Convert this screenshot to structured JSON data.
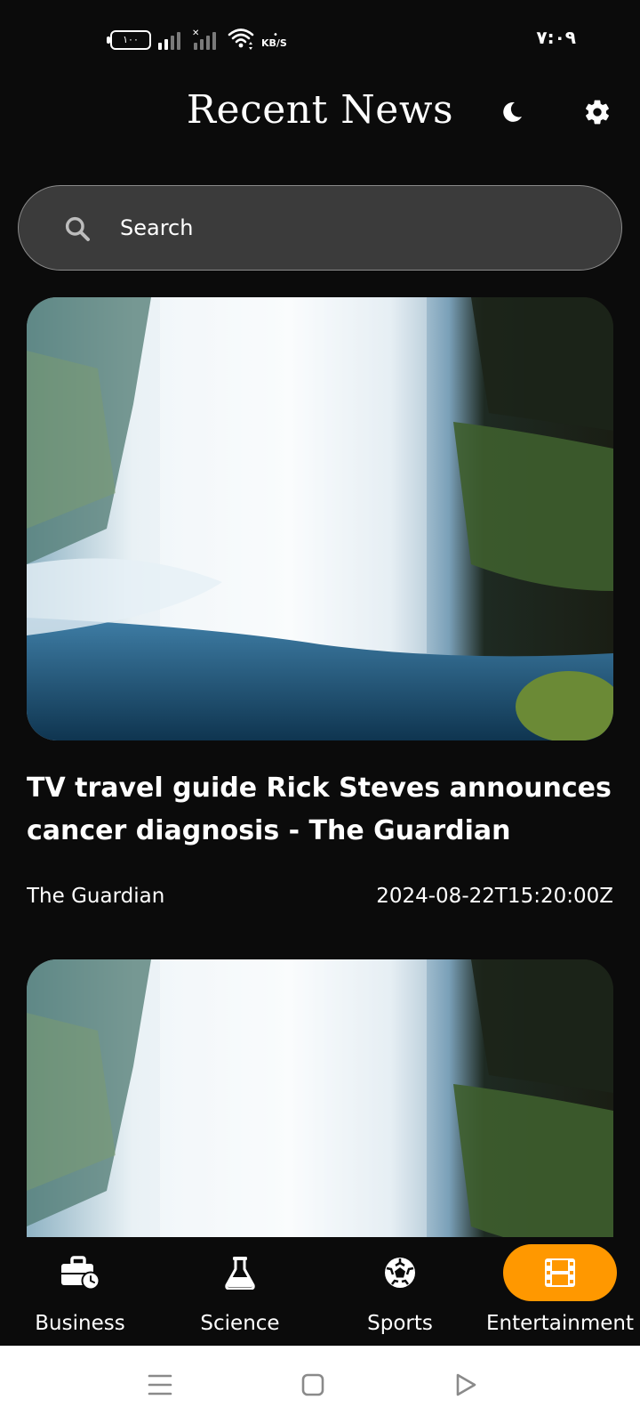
{
  "status_bar": {
    "battery": "١٠٠",
    "speed_unit": "KB/S",
    "time": "٧:٠٩"
  },
  "header": {
    "title": "Recent News",
    "icons": [
      "moon-icon",
      "gear-icon"
    ]
  },
  "search": {
    "placeholder": "Search",
    "icon": "search-icon"
  },
  "articles": [
    {
      "headline": "TV travel guide Rick Steves announces cancer diagnosis - The Guardian",
      "source": "The Guardian",
      "published": "2024-08-22T15:20:00Z",
      "image": "waterfall-image"
    },
    {
      "image": "waterfall-image"
    }
  ],
  "bottom_nav": {
    "items": [
      {
        "label": "Business",
        "icon": "briefcase-clock-icon",
        "active": false
      },
      {
        "label": "Science",
        "icon": "flask-icon",
        "active": false
      },
      {
        "label": "Sports",
        "icon": "soccer-ball-icon",
        "active": false
      },
      {
        "label": "Entertainment",
        "icon": "film-icon",
        "active": true
      }
    ],
    "active_color": "#ff9800"
  },
  "system_nav": {
    "icons": [
      "menu-icon",
      "home-icon",
      "back-icon"
    ]
  },
  "colors": {
    "background": "#0b0b0b",
    "search_bg": "#3b3b3b",
    "accent": "#ff9800"
  }
}
